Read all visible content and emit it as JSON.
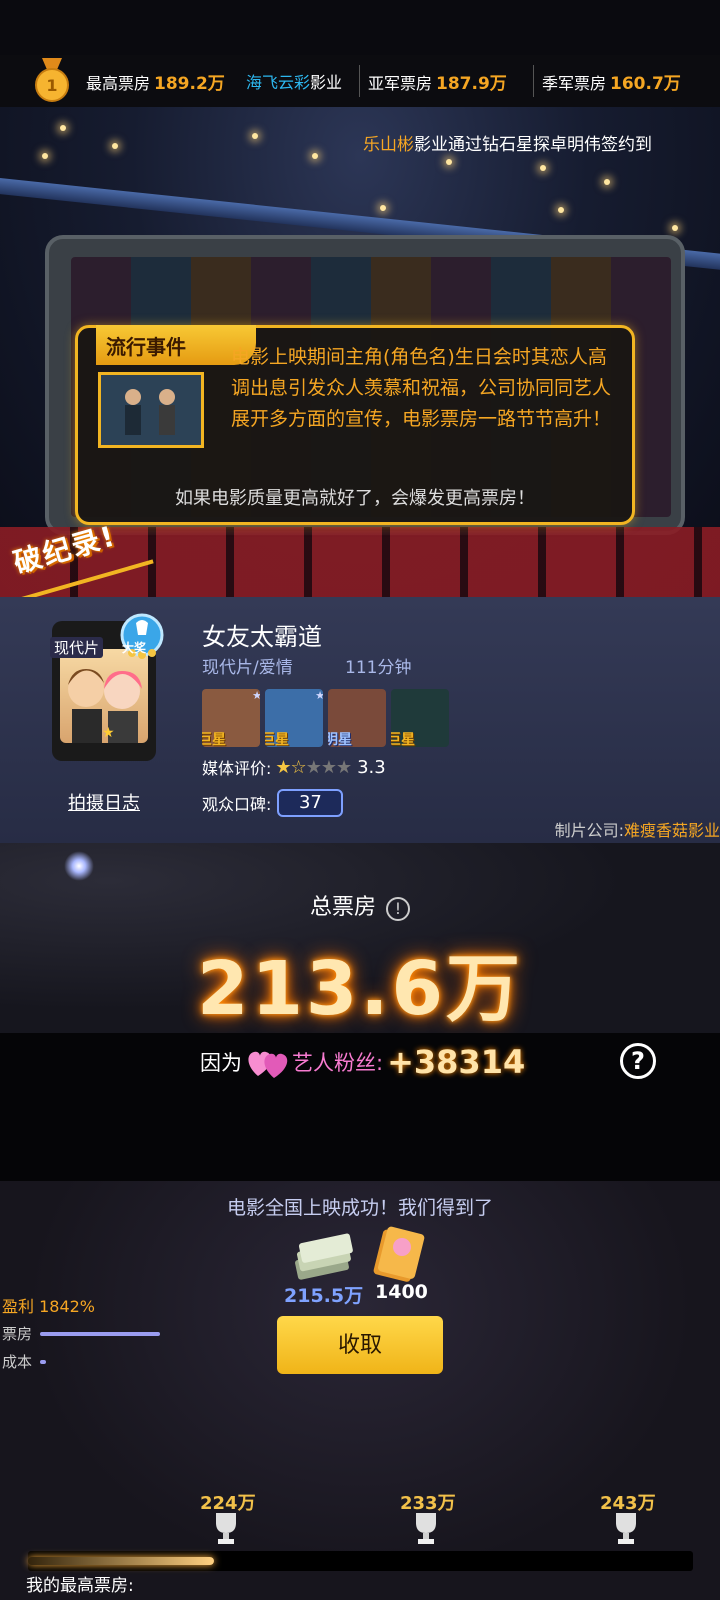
{
  "top_bar": {
    "first": {
      "label": "最高票房",
      "value": "189.2万"
    },
    "studio": {
      "name": "海飞云彩",
      "suffix": "影业"
    },
    "second": {
      "label": "亚军票房",
      "value": "187.9万"
    },
    "third": {
      "label": "季军票房",
      "value": "160.7万"
    }
  },
  "ticker": {
    "name": "乐山彬",
    "text": "影业通过钻石星探卓明伟签约到"
  },
  "event": {
    "tag": "流行事件",
    "text": "电影上映期间主角(角色名)生日会时其恋人高调出息引发众人羡慕和祝福，公司协同同艺人展开多方面的宣传，电影票房一路节节高升！",
    "footer": "如果电影质量更高就好了，会爆发更高票房！"
  },
  "record_badge": "破纪录!",
  "movie": {
    "poster_label": "现代片",
    "award": "大奖",
    "title": "女友太霸道",
    "genre": "现代片/爱情",
    "length": "111分钟",
    "cast": [
      {
        "tag": "巨星",
        "color": "#8a5a40",
        "tag_style": "gold"
      },
      {
        "tag": "巨星",
        "color": "#3c6ea8",
        "tag_style": "gold"
      },
      {
        "tag": "明星",
        "color": "#7a4a3a",
        "tag_style": "blue"
      },
      {
        "tag": "巨星",
        "color": "#1f3a3a",
        "tag_style": "gold"
      }
    ],
    "media_label": "媒体评价:",
    "media_rating": "3.3",
    "media_stars": 1.5,
    "praise_label": "观众口碑:",
    "praise_value": "37",
    "diary": "拍摄日志",
    "producer_label": "制片公司:",
    "producer": "难瘦香菇影业"
  },
  "box_office": {
    "label": "总票房",
    "value": "213.6万"
  },
  "fans": {
    "prefix": "因为",
    "label": "艺人粉丝:",
    "value": "+38314"
  },
  "reward": {
    "title": "电影全国上映成功！我们得到了",
    "money": "215.5万",
    "books": "1400",
    "profit": "盈利 1842%",
    "box_label": "票房",
    "cost_label": "成本",
    "box_fraction": 1.0,
    "cost_fraction": 0.05,
    "collect": "收取"
  },
  "milestones": [
    {
      "label": "224万"
    },
    {
      "label": "233万"
    },
    {
      "label": "243万"
    }
  ],
  "progress_fraction": 0.28,
  "my_best_label": "我的最高票房:",
  "colors": {
    "gold": "#f5a623",
    "accent_blue": "#2db8f0",
    "button": "#f0b418"
  }
}
